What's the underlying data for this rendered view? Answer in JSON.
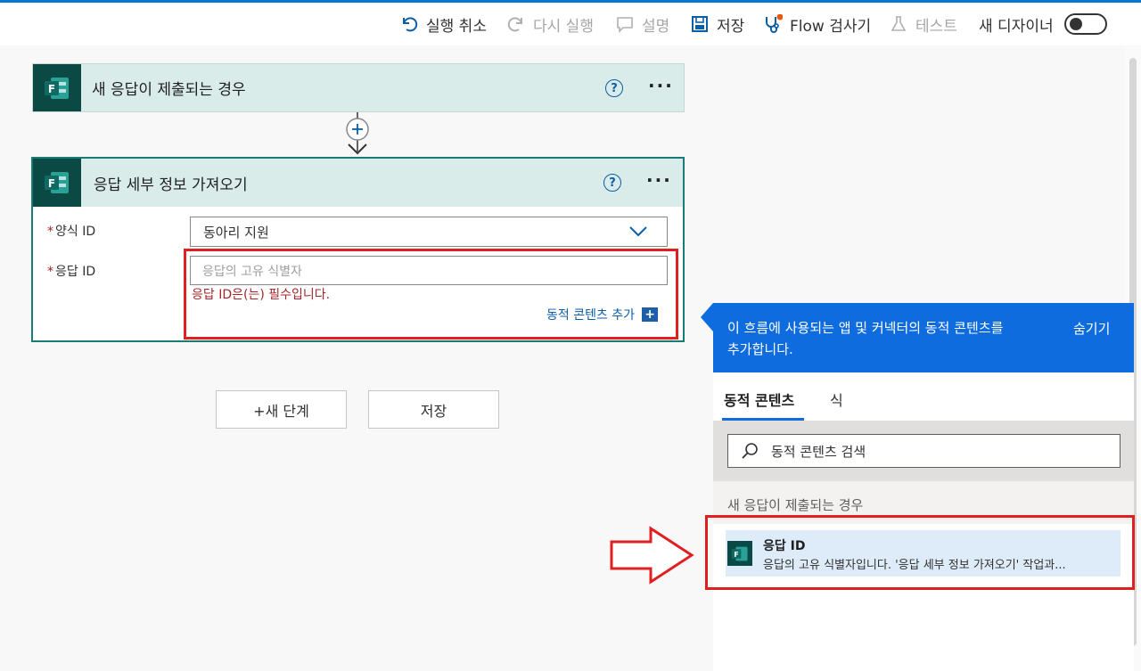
{
  "toolbar": {
    "undo_label": "실행 취소",
    "redo_label": "다시 실행",
    "comment_label": "설명",
    "save_label": "저장",
    "checker_label": "Flow 검사기",
    "test_label": "테스트",
    "new_designer_label": "새 디자이너"
  },
  "trigger": {
    "title": "새 응답이 제출되는 경우",
    "icon": "forms-icon"
  },
  "action": {
    "title": "응답 세부 정보 가져오기",
    "form_id_label": "양식 ID",
    "form_id_value": "동아리 지원",
    "response_id_label": "응답 ID",
    "response_id_placeholder": "응답의 고유 식별자",
    "error_text": "응답 ID은(는) 필수입니다.",
    "add_dynamic_label": "동적 콘텐츠 추가"
  },
  "buttons": {
    "new_step": "+새 단계",
    "save": "저장"
  },
  "panel": {
    "banner_text_line1": "이 흐름에 사용되는 앱 및 커넥터의 동적 콘텐츠를",
    "banner_text_line2": "추가합니다.",
    "hide_label": "숨기기",
    "tabs": [
      "동적 콘텐츠",
      "식"
    ],
    "search_placeholder": "동적 콘텐츠 검색",
    "group_header": "새 응답이 제출되는 경우",
    "item": {
      "title": "응답 ID",
      "description": "응답의 고유 식별자입니다. '응답 세부 정보 가져오기' 작업과..."
    }
  },
  "colors": {
    "accent": "#0f6cde",
    "error": "#a4262c",
    "highlight": "#e02020",
    "forms_brand": "#0b4a44"
  }
}
